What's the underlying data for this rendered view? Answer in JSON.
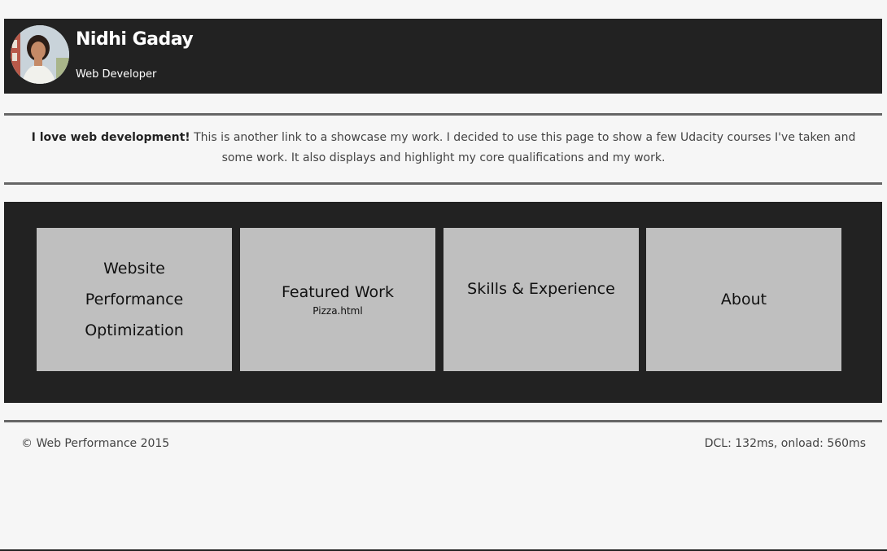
{
  "header": {
    "name": "Nidhi Gaday",
    "role": "Web Developer",
    "avatar_icon": "profile-photo"
  },
  "intro": {
    "lead": "I love web development!",
    "body": " This is another link to a showcase my work. I decided to use this page to show a few Udacity courses I've taken and some work. It also displays and highlight my core qualifications and my work."
  },
  "tiles": [
    {
      "title_lines": [
        "Website",
        "Performance",
        "Optimization"
      ]
    },
    {
      "title": "Featured Work",
      "subtitle": "Pizza.html"
    },
    {
      "title": "Skills & Experience"
    },
    {
      "title": "About"
    }
  ],
  "footer": {
    "copyright": "© Web Performance 2015",
    "timing": "DCL: 132ms, onload: 560ms"
  },
  "colors": {
    "header_bg": "#222222",
    "tile_bg": "#bfbfbf",
    "rule": "#666666",
    "page_bg": "#f6f6f6"
  }
}
